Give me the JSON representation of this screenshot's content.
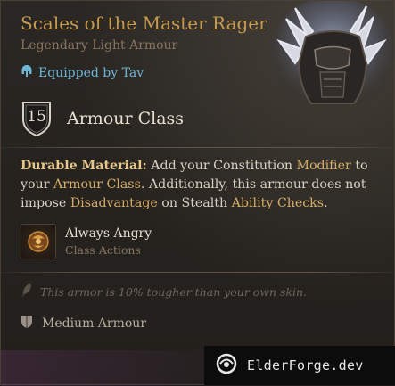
{
  "item": {
    "name": "Scales of the Master Rager",
    "rarity_type": "Legendary Light Armour",
    "equipped": "Equipped by Tav"
  },
  "stats": {
    "armour_class_value": "15",
    "armour_class_label": "Armour Class"
  },
  "description": {
    "heading": "Durable Material:",
    "parts": [
      " Add your Constitution ",
      "Modifier",
      " to your ",
      "Armour Class",
      ". Additionally, this armour does not impose ",
      "Disadvantage",
      " on Stealth ",
      "Ability Checks",
      "."
    ]
  },
  "action": {
    "name": "Always Angry",
    "category": "Class Actions"
  },
  "flavor_text": "This armor is 10% tougher than your own skin.",
  "armour_type": "Medium Armour",
  "watermark": "ElderForge.dev",
  "colors": {
    "title": "#c79a4e",
    "equipped": "#6fb6d6",
    "keyword": "#d6ae6a"
  }
}
